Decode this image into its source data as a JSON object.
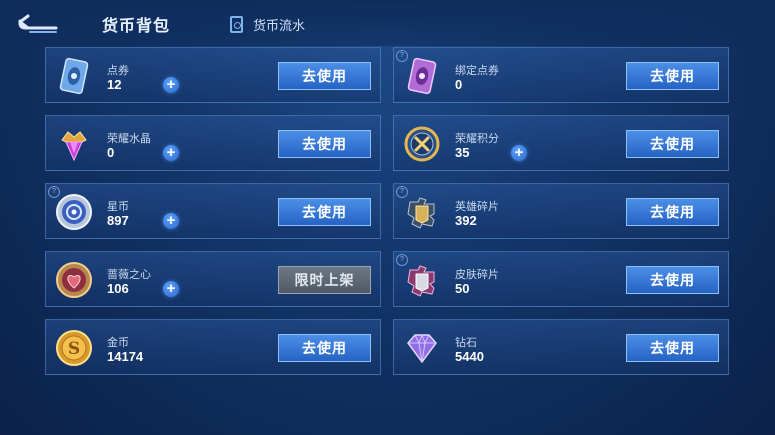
{
  "header": {
    "title": "货币背包",
    "ledger_tab": "货币流水"
  },
  "accent_color": "#3a7ae0",
  "cards": [
    {
      "name": "点券",
      "value": "12",
      "button": "去使用",
      "icon": "coupon-icon"
    },
    {
      "name": "绑定点券",
      "value": "0",
      "button": "去使用",
      "icon": "bound-coupon-icon"
    },
    {
      "name": "荣耀水晶",
      "value": "0",
      "button": "去使用",
      "icon": "glory-crystal-icon"
    },
    {
      "name": "荣耀积分",
      "value": "35",
      "button": "去使用",
      "icon": "glory-points-icon"
    },
    {
      "name": "星币",
      "value": "897",
      "button": "去使用",
      "icon": "star-coin-icon"
    },
    {
      "name": "英雄碎片",
      "value": "392",
      "button": "去使用",
      "icon": "hero-shard-icon"
    },
    {
      "name": "蔷薇之心",
      "value": "106",
      "button": "限时上架",
      "icon": "rose-heart-icon"
    },
    {
      "name": "皮肤碎片",
      "value": "50",
      "button": "去使用",
      "icon": "skin-shard-icon"
    },
    {
      "name": "金币",
      "value": "14174",
      "button": "去使用",
      "icon": "gold-coin-icon"
    },
    {
      "name": "钻石",
      "value": "5440",
      "button": "去使用",
      "icon": "diamond-icon"
    }
  ]
}
